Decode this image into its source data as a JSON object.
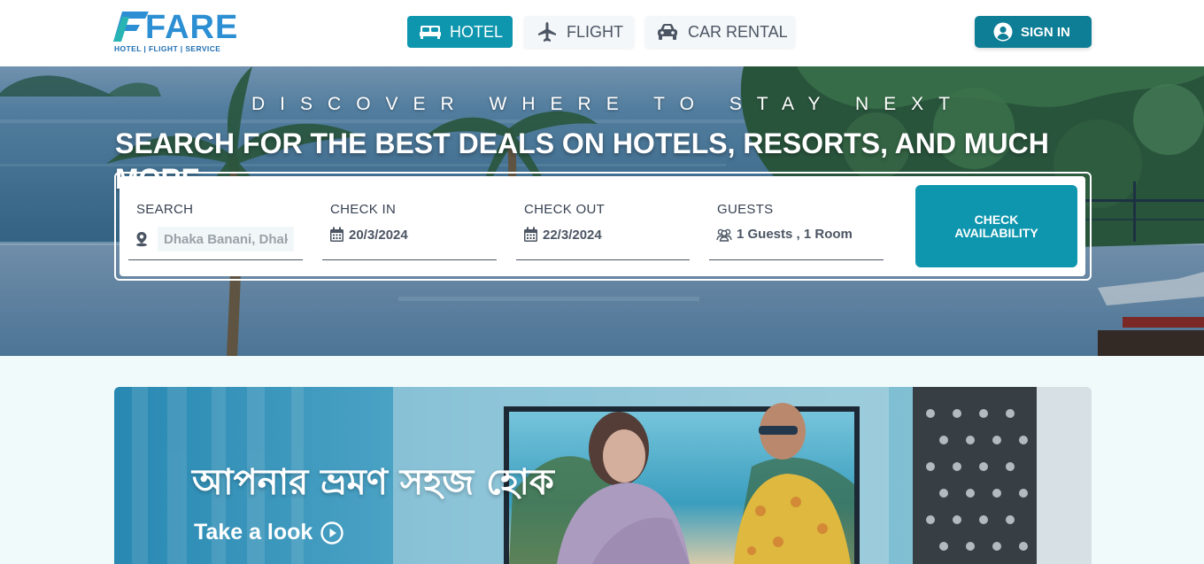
{
  "header": {
    "logo": {
      "word": "FARE",
      "tagline": "HOTEL | FLIGHT | SERVICE"
    },
    "tabs": [
      {
        "label": "HOTEL",
        "icon": "bed-icon",
        "active": true
      },
      {
        "label": "FLIGHT",
        "icon": "airplane-icon",
        "active": false
      },
      {
        "label": "CAR RENTAL",
        "icon": "car-icon",
        "active": false
      }
    ],
    "signin_label": "SIGN IN"
  },
  "hero": {
    "kicker": "DISCOVER WHERE TO STAY NEXT",
    "title": "SEARCH FOR THE BEST DEALS ON HOTELS, RESORTS, AND MUCH MORE...",
    "search": {
      "location": {
        "label": "SEARCH",
        "value": "Dhaka Banani, Dhaka"
      },
      "check_in": {
        "label": "CHECK IN",
        "value": "20/3/2024"
      },
      "check_out": {
        "label": "CHECK OUT",
        "value": "22/3/2024"
      },
      "guests": {
        "label": "GUESTS",
        "value": "1 Guests , 1 Room"
      },
      "button_label": "CHECK AVAILABILITY"
    }
  },
  "promo": {
    "title": "আপনার ভ্রমণ সহজ হোক",
    "link_label": "Take a look"
  },
  "colors": {
    "accent": "#0e96ae",
    "signin": "#0d7e96",
    "logo_blue": "#2d8fd3",
    "page_bg": "#f1fafb"
  }
}
